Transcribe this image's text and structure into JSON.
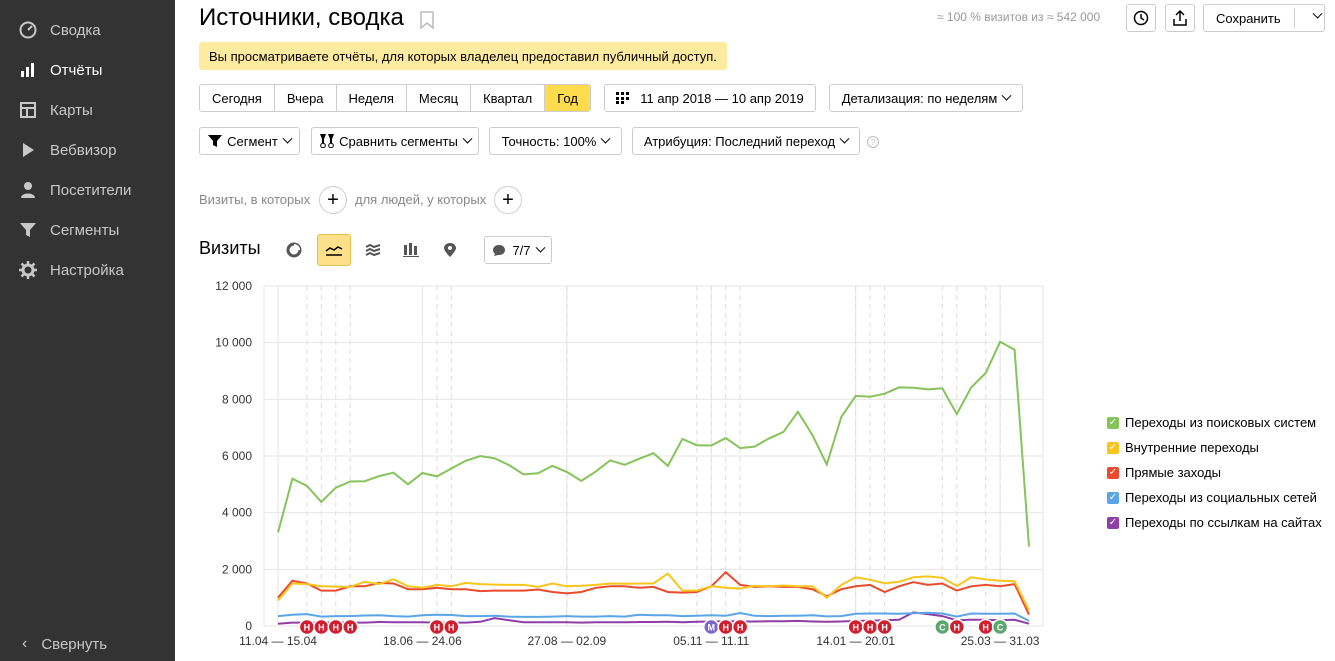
{
  "sidebar": {
    "items": [
      {
        "label": "Сводка",
        "icon": "gauge-icon"
      },
      {
        "label": "Отчёты",
        "icon": "bar-chart-icon"
      },
      {
        "label": "Карты",
        "icon": "map-icon"
      },
      {
        "label": "Вебвизор",
        "icon": "play-icon"
      },
      {
        "label": "Посетители",
        "icon": "user-icon"
      },
      {
        "label": "Сегменты",
        "icon": "funnel-icon"
      },
      {
        "label": "Настройка",
        "icon": "gear-icon"
      }
    ],
    "collapse_label": "Свернуть"
  },
  "header": {
    "title": "Источники, сводка",
    "visit_stats": "≈ 100 % визитов из ≈ 542 000",
    "save_label": "Сохранить"
  },
  "banner": {
    "text": "Вы просматриваете отчёты, для которых владелец предоставил публичный доступ."
  },
  "period": {
    "options": [
      "Сегодня",
      "Вчера",
      "Неделя",
      "Месяц",
      "Квартал",
      "Год"
    ],
    "active": "Год",
    "date_range": "11 апр 2018 — 10 апр 2019",
    "detail": "Детализация: по неделям"
  },
  "filters": {
    "segment": "Сегмент",
    "compare": "Сравнить сегменты",
    "accuracy": "Точность: 100%",
    "attribution": "Атрибуция: Последний переход"
  },
  "conditions": {
    "visits_label": "Визиты, в которых",
    "people_label": "для людей, у которых"
  },
  "chart_section": {
    "title": "Визиты",
    "annotations_label": "7/7"
  },
  "chart_data": {
    "type": "line",
    "ylim": [
      0,
      12000
    ],
    "yticks": [
      0,
      2000,
      4000,
      6000,
      8000,
      10000,
      12000
    ],
    "ytick_labels": [
      "0",
      "2 000",
      "4 000",
      "6 000",
      "8 000",
      "10 000",
      "12 000"
    ],
    "xtick_labels": [
      {
        "label": "11.04 — 15.04",
        "index": 0
      },
      {
        "label": "18.06 — 24.06",
        "index": 10
      },
      {
        "label": "27.08 — 02.09",
        "index": 20
      },
      {
        "label": "05.11 — 11.11",
        "index": 30
      },
      {
        "label": "14.01 — 20.01",
        "index": 40
      },
      {
        "label": "25.03 — 31.03",
        "index": 50
      }
    ],
    "n_points": 53,
    "series": [
      {
        "name": "Переходы из поисковых систем",
        "color": "#86c35a",
        "values": [
          3300,
          5200,
          4950,
          4380,
          4880,
          5100,
          5110,
          5290,
          5410,
          5000,
          5400,
          5280,
          5560,
          5830,
          6000,
          5920,
          5680,
          5350,
          5390,
          5650,
          5440,
          5120,
          5450,
          5850,
          5690,
          5900,
          6100,
          5650,
          6600,
          6380,
          6370,
          6630,
          6280,
          6330,
          6620,
          6850,
          7560,
          6740,
          5700,
          7380,
          8120,
          8090,
          8200,
          8420,
          8410,
          8350,
          8390,
          7480,
          8420,
          8930,
          10030,
          9750,
          2800
        ]
      },
      {
        "name": "Внутренние переходы",
        "color": "#f8c51c",
        "values": [
          900,
          1500,
          1480,
          1400,
          1390,
          1380,
          1560,
          1480,
          1650,
          1400,
          1350,
          1450,
          1400,
          1520,
          1480,
          1460,
          1450,
          1450,
          1380,
          1500,
          1400,
          1420,
          1450,
          1500,
          1490,
          1500,
          1500,
          1850,
          1250,
          1250,
          1400,
          1350,
          1320,
          1420,
          1400,
          1430,
          1400,
          1400,
          1000,
          1450,
          1720,
          1630,
          1510,
          1560,
          1720,
          1750,
          1700,
          1410,
          1720,
          1640,
          1600,
          1580,
          550
        ]
      },
      {
        "name": "Прямые заходы",
        "color": "#ea4b2c",
        "values": [
          1000,
          1600,
          1500,
          1250,
          1250,
          1400,
          1400,
          1520,
          1500,
          1300,
          1300,
          1350,
          1300,
          1300,
          1230,
          1250,
          1250,
          1250,
          1290,
          1200,
          1150,
          1200,
          1350,
          1400,
          1400,
          1350,
          1380,
          1200,
          1180,
          1200,
          1400,
          1900,
          1450,
          1380,
          1400,
          1380,
          1380,
          1300,
          1050,
          1300,
          1400,
          1450,
          1200,
          1400,
          1550,
          1450,
          1500,
          1250,
          1400,
          1450,
          1400,
          1480,
          400
        ]
      },
      {
        "name": "Переходы из социальных сетей",
        "color": "#5aa5e8",
        "values": [
          350,
          400,
          420,
          330,
          350,
          350,
          370,
          380,
          350,
          330,
          380,
          400,
          390,
          350,
          350,
          360,
          330,
          320,
          320,
          330,
          350,
          330,
          330,
          350,
          330,
          400,
          380,
          380,
          350,
          360,
          380,
          360,
          460,
          360,
          350,
          360,
          360,
          380,
          340,
          350,
          430,
          440,
          440,
          430,
          450,
          470,
          440,
          330,
          440,
          430,
          430,
          440,
          180
        ]
      },
      {
        "name": "Переходы по ссылкам на сайтах",
        "color": "#8e3ea6",
        "values": [
          80,
          120,
          120,
          120,
          130,
          120,
          120,
          140,
          130,
          130,
          130,
          120,
          120,
          120,
          150,
          280,
          200,
          130,
          130,
          130,
          130,
          120,
          130,
          130,
          130,
          140,
          140,
          150,
          130,
          150,
          160,
          170,
          160,
          160,
          170,
          170,
          180,
          160,
          150,
          160,
          180,
          190,
          200,
          220,
          480,
          420,
          350,
          200,
          220,
          220,
          200,
          220,
          80
        ]
      }
    ],
    "annotation_markers": [
      {
        "label": "Н",
        "index": 2,
        "color": "#d02030"
      },
      {
        "label": "Н",
        "index": 3,
        "color": "#d02030"
      },
      {
        "label": "Н",
        "index": 4,
        "color": "#d02030"
      },
      {
        "label": "Н",
        "index": 5,
        "color": "#d02030"
      },
      {
        "label": "Н",
        "index": 11,
        "color": "#d02030"
      },
      {
        "label": "Н",
        "index": 12,
        "color": "#d02030"
      },
      {
        "label": "М",
        "index": 30,
        "color": "#7b68c9"
      },
      {
        "label": "Н",
        "index": 31,
        "color": "#d02030"
      },
      {
        "label": "Н",
        "index": 32,
        "color": "#d02030"
      },
      {
        "label": "Н",
        "index": 40,
        "color": "#d02030"
      },
      {
        "label": "Н",
        "index": 41,
        "color": "#d02030"
      },
      {
        "label": "Н",
        "index": 42,
        "color": "#d02030"
      },
      {
        "label": "С",
        "index": 46,
        "color": "#5aa870"
      },
      {
        "label": "Н",
        "index": 47,
        "color": "#d02030"
      },
      {
        "label": "Н",
        "index": 49,
        "color": "#d02030"
      },
      {
        "label": "С",
        "index": 50,
        "color": "#5aa870"
      }
    ],
    "annotation_lines": [
      2,
      3,
      4,
      5,
      11,
      12,
      20,
      29,
      30,
      31,
      32,
      40,
      41,
      42,
      46,
      47,
      49,
      50
    ]
  }
}
